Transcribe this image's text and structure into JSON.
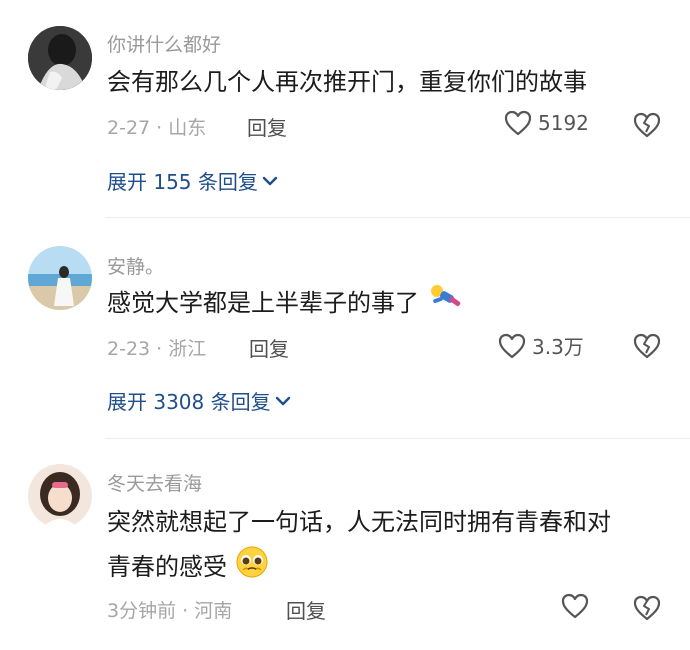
{
  "comments": [
    {
      "username": "你讲什么都好",
      "text": "会有那么几个人再次推开门，重复你们的故事",
      "date_location": "2-27 · 山东",
      "reply_label": "回复",
      "likes": "5192",
      "expand_label": "展开 155 条回复"
    },
    {
      "username": "安静。",
      "text": "感觉大学都是上半辈子的事了",
      "date_location": "2-23 · 浙江",
      "reply_label": "回复",
      "likes": "3.3万",
      "expand_label": "展开 3308 条回复"
    },
    {
      "username": "冬天去看海",
      "text_line1": "突然就想起了一句话，人无法同时拥有青春和对",
      "text_line2": "青春的感受",
      "date_location": "3分钟前 · 河南",
      "reply_label": "回复"
    }
  ],
  "icons": {
    "like": "heart-outline-icon",
    "dislike": "broken-heart-icon",
    "expand": "chevron-down-icon",
    "emoji_1": "falling-person-emoji",
    "emoji_2": "pleading-face-emoji"
  },
  "colors": {
    "link": "#1f4e8c",
    "meta": "#a6a6a6",
    "username": "#9a9a9a"
  }
}
